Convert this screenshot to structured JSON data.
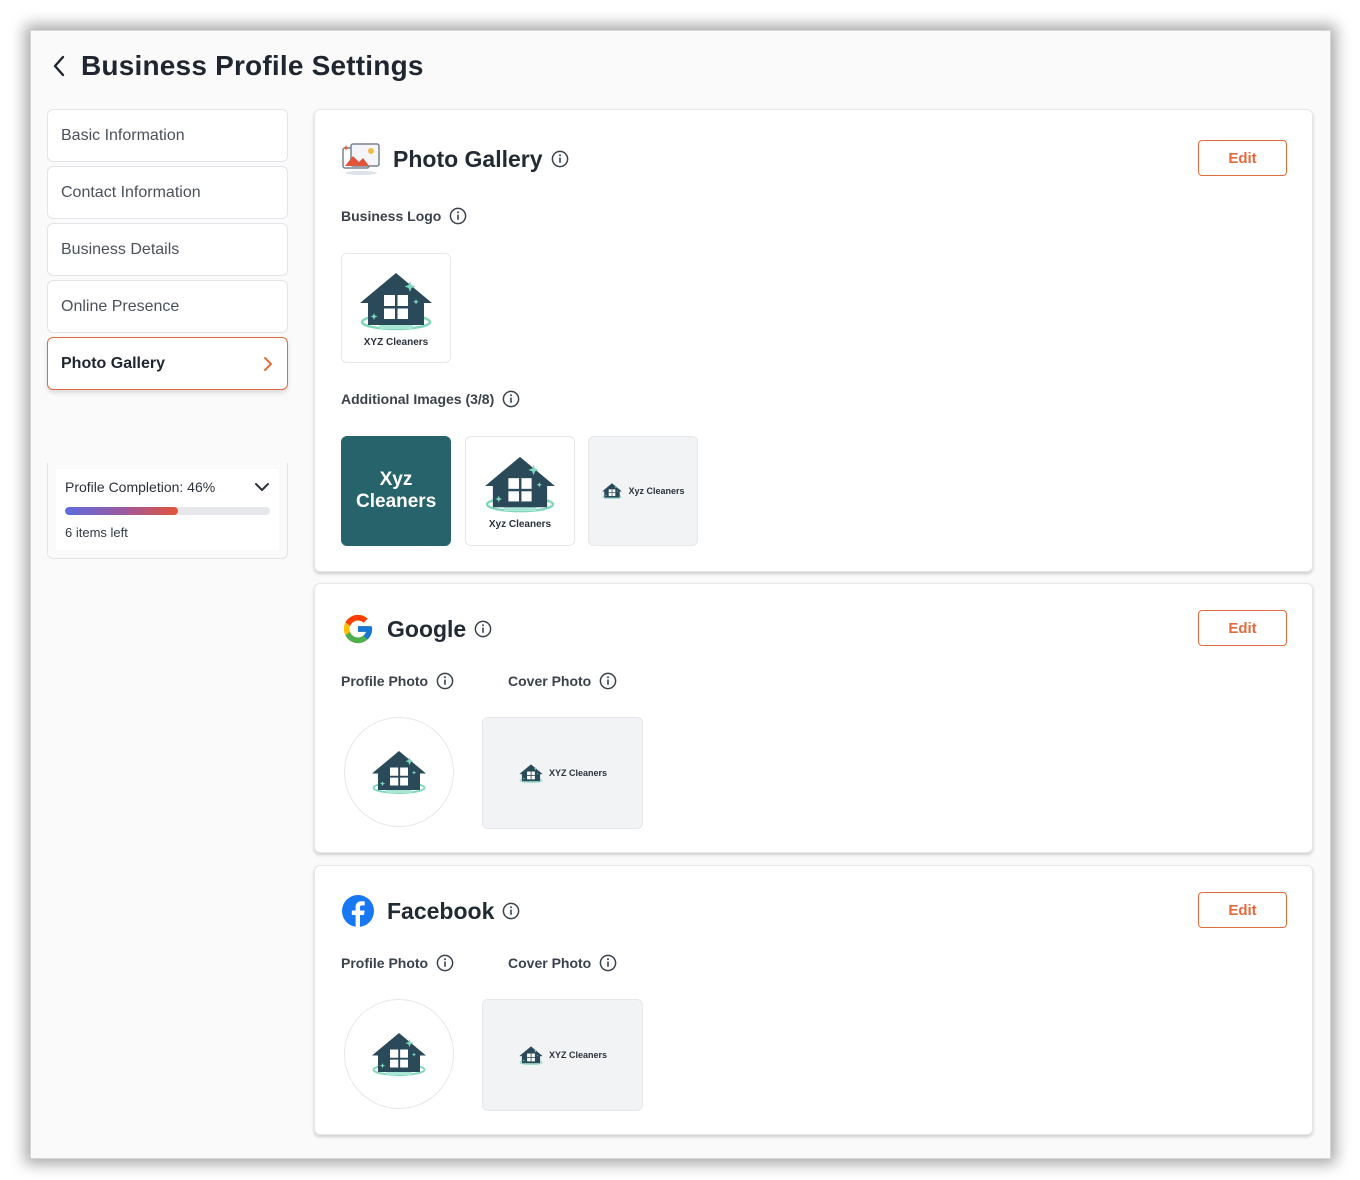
{
  "page": {
    "title": "Business Profile Settings"
  },
  "sidebar": {
    "items": [
      {
        "label": "Basic Information"
      },
      {
        "label": "Contact Information"
      },
      {
        "label": "Business Details"
      },
      {
        "label": "Online Presence"
      },
      {
        "label": "Photo Gallery",
        "active": true
      }
    ],
    "completion": {
      "label": "Profile Completion: 46%",
      "percent": 46,
      "items_left": "6 items left"
    }
  },
  "photo_gallery": {
    "title": "Photo Gallery",
    "edit_label": "Edit",
    "business_logo_label": "Business Logo",
    "logo_caption": "XYZ Cleaners",
    "additional_images_label": "Additional Images (3/8)",
    "images": [
      {
        "text": "Xyz Cleaners"
      },
      {
        "caption": "Xyz Cleaners"
      },
      {
        "caption": "Xyz Cleaners"
      }
    ]
  },
  "google": {
    "title": "Google",
    "edit_label": "Edit",
    "profile_photo_label": "Profile Photo",
    "cover_photo_label": "Cover Photo",
    "cover_caption": "XYZ Cleaners"
  },
  "facebook": {
    "title": "Facebook",
    "edit_label": "Edit",
    "profile_photo_label": "Profile Photo",
    "cover_photo_label": "Cover Photo",
    "cover_caption": "XYZ Cleaners"
  },
  "colors": {
    "accent": "#e26b3d",
    "teal": "#27636b",
    "house_dark": "#2a4a5a",
    "house_mint": "#7fd6bd"
  }
}
